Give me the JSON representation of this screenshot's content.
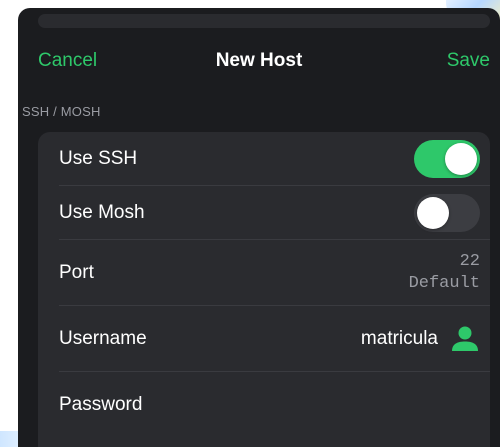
{
  "navbar": {
    "cancel_label": "Cancel",
    "title": "New Host",
    "save_label": "Save"
  },
  "section": {
    "header": "SSH / MOSH"
  },
  "rows": {
    "use_ssh": {
      "label": "Use SSH",
      "enabled": true
    },
    "use_mosh": {
      "label": "Use Mosh",
      "enabled": false
    },
    "port": {
      "label": "Port",
      "value": "22",
      "placeholder": "Default"
    },
    "username": {
      "label": "Username",
      "value": "matricula",
      "icon": "person-icon"
    },
    "password": {
      "label": "Password"
    }
  },
  "colors": {
    "accent": "#2ec86a",
    "sheet_background": "#1b1c1f",
    "group_background": "#2a2b2f",
    "secondary_text": "#9a9ca3"
  }
}
